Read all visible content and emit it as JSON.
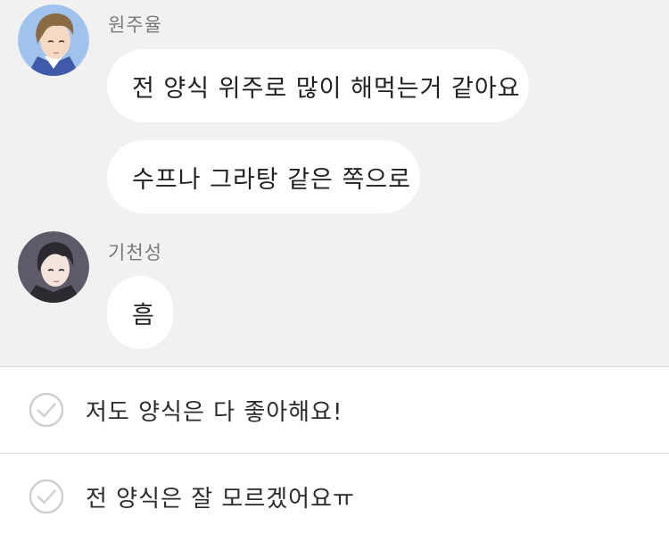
{
  "chat": {
    "messages": [
      {
        "sender": "원주율",
        "avatar_icon": "avatar-brown-hair-icon",
        "bubbles": [
          "전 양식 위주로 많이 해먹는거 같아요",
          "수프나 그라탕 같은 쪽으로"
        ]
      },
      {
        "sender": "기천성",
        "avatar_icon": "avatar-dark-hair-icon",
        "bubbles": [
          "흠"
        ]
      }
    ]
  },
  "choices": [
    {
      "label": "저도 양식은 다 좋아해요!",
      "icon": "check-circle-icon"
    },
    {
      "label": "전 양식은 잘 모르겠어요ㅠ",
      "icon": "check-circle-icon"
    }
  ],
  "colors": {
    "chat_background": "#f1f1f1",
    "bubble": "#ffffff",
    "check_outline": "#cfcfcf"
  }
}
